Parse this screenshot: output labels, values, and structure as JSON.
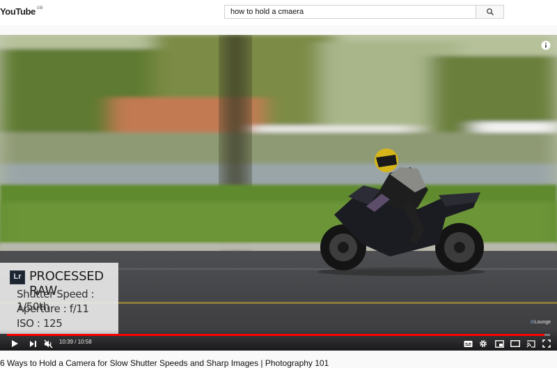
{
  "header": {
    "logo_text": "YouTube",
    "logo_country": "GB",
    "search_value": "how to hold a cmaera",
    "search_icon": "search-icon"
  },
  "player": {
    "overlay": {
      "badge": "Lr",
      "title": "PROCESSED RAW",
      "lines": [
        "Shutter Speed : 1/50th",
        "Aperture : f/11",
        "ISO : 125"
      ]
    },
    "watermark": "Lounge",
    "progress_fraction": 0.99,
    "time_current": "10:39",
    "time_total": "10:58",
    "time_display": "10:39 / 10:58",
    "colors": {
      "progress": "#ff0000"
    }
  },
  "video": {
    "title": "6 Ways to Hold a Camera for Slow Shutter Speeds and Sharp Images | Photography 101"
  }
}
